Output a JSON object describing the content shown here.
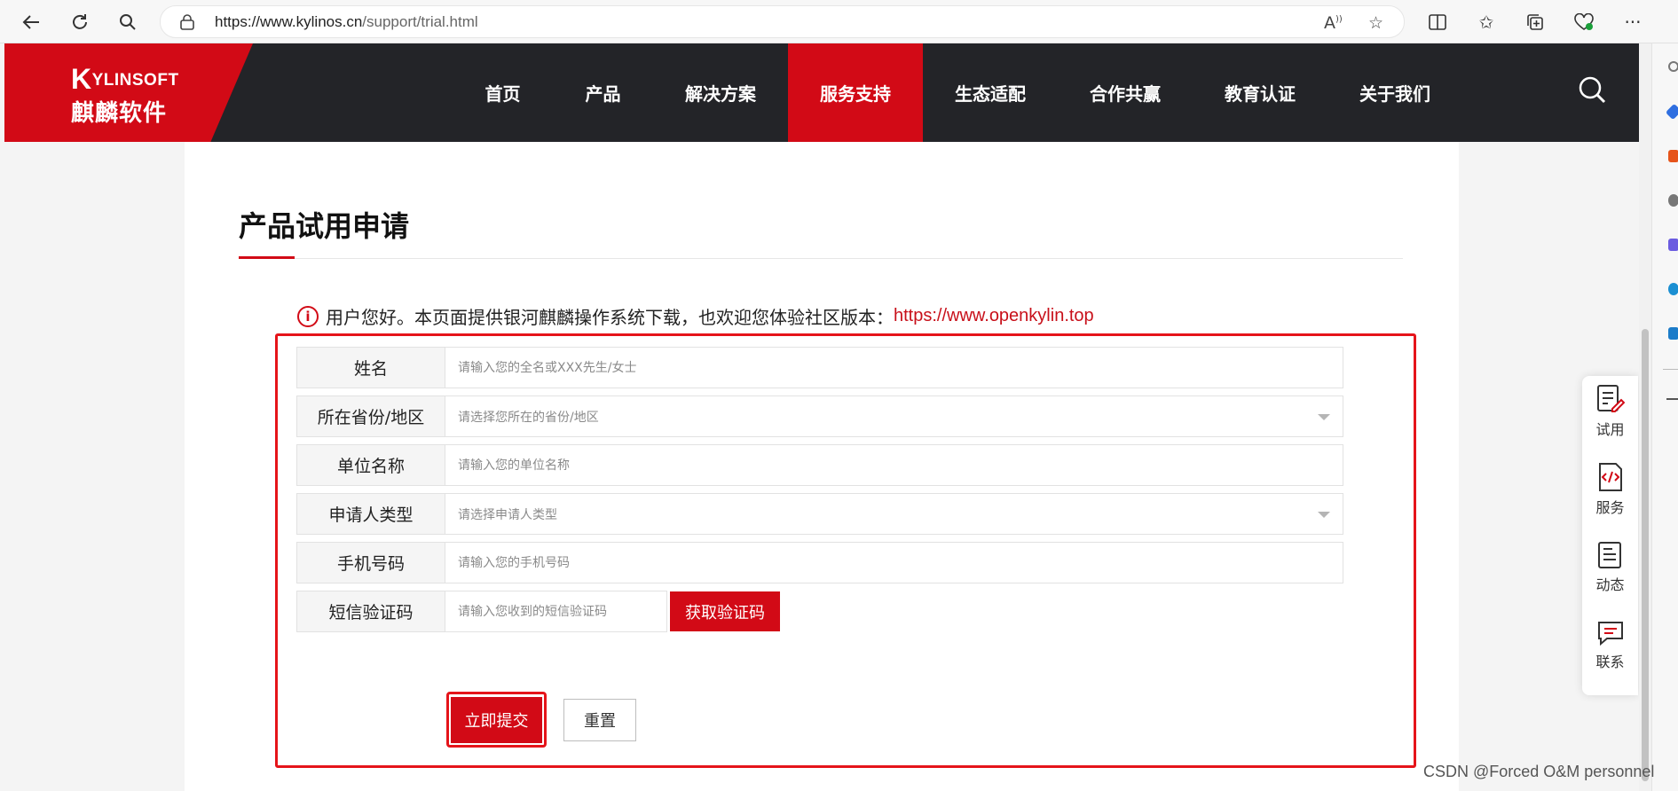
{
  "browser": {
    "url_host": "https://www.kylinos.cn",
    "url_path": "/support/trial.html"
  },
  "site": {
    "logo_en_k": "K",
    "logo_en_rest": "YLINSOFT",
    "logo_cn": "麒麟软件",
    "menu": [
      {
        "label": "首页",
        "width": 113
      },
      {
        "label": "产品",
        "width": 113
      },
      {
        "label": "解决方案",
        "width": 152
      },
      {
        "label": "服务支持",
        "width": 152
      },
      {
        "label": "生态适配",
        "width": 152
      },
      {
        "label": "合作共赢",
        "width": 152
      },
      {
        "label": "教育认证",
        "width": 152
      },
      {
        "label": "关于我们",
        "width": 152
      }
    ],
    "active_menu": "服务支持",
    "brand_color": "#d20a16"
  },
  "page": {
    "title": "产品试用申请",
    "notice_text": "用户您好。本页面提供银河麒麟操作系统下载，也欢迎您体验社区版本：",
    "notice_link": "https://www.openkylin.top"
  },
  "form": {
    "name_label": "姓名",
    "name_placeholder": "请输入您的全名或XXX先生/女士",
    "region_label": "所在省份/地区",
    "region_placeholder": "请选择您所在的省份/地区",
    "org_label": "单位名称",
    "org_placeholder": "请输入您的单位名称",
    "type_label": "申请人类型",
    "type_placeholder": "请选择申请人类型",
    "phone_label": "手机号码",
    "phone_placeholder": "请输入您的手机号码",
    "sms_label": "短信验证码",
    "sms_placeholder": "请输入您收到的短信验证码",
    "sms_button": "获取验证码",
    "submit_button": "立即提交",
    "reset_button": "重置"
  },
  "float_panel": {
    "trial": "试用",
    "service": "服务",
    "news": "动态",
    "contact": "联系"
  },
  "watermark": "CSDN @Forced O&M personnel"
}
